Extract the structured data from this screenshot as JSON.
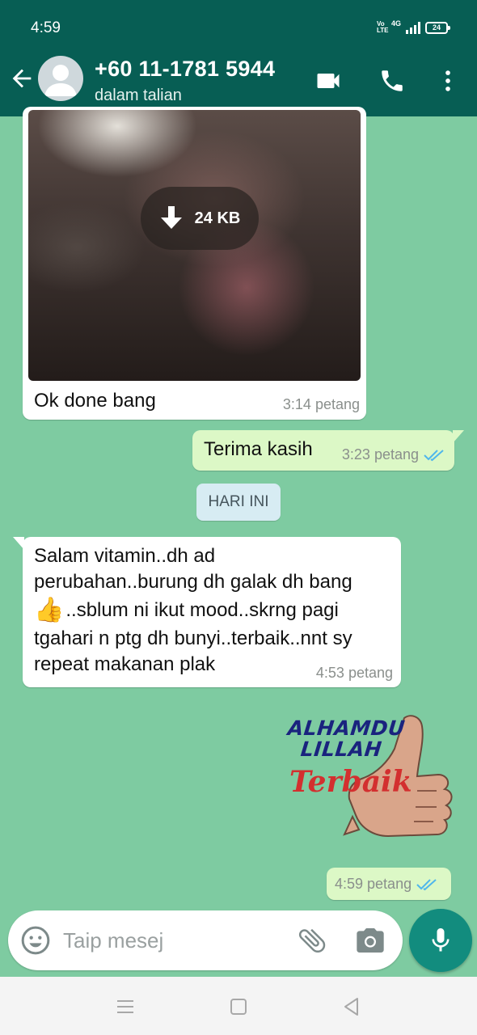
{
  "status_bar": {
    "time": "4:59",
    "volte_label": "Vo LTE",
    "network": "4G",
    "battery": "24"
  },
  "header": {
    "contact_name": "+60 11-1781 5944",
    "contact_status": "dalam talian",
    "background_color": "#075e54"
  },
  "messages": [
    {
      "direction": "incoming",
      "type": "image",
      "download_size": "24 KB",
      "caption": "Ok done bang",
      "time": "3:14 petang"
    },
    {
      "direction": "outgoing",
      "type": "text",
      "text": "Terima kasih",
      "time": "3:23 petang",
      "receipt": "read"
    },
    {
      "type": "date_separator",
      "text": "HARI INI"
    },
    {
      "direction": "incoming",
      "type": "text",
      "lines": [
        "Salam vitamin..dh ad",
        "perubahan..burung dh galak dh bang",
        "..sblum ni ikut mood..skrng pagi",
        "tgahari n ptg dh bunyi..terbaik..nnt sy",
        "repeat makanan plak"
      ],
      "emoji": "👍",
      "time": "4:53 petang"
    },
    {
      "direction": "outgoing",
      "type": "sticker",
      "sticker_lines": [
        "ALHAMDU",
        "LILLAH",
        "Terbaik"
      ],
      "time": "4:59 petang",
      "receipt": "read"
    }
  ],
  "composer": {
    "placeholder": "Taip mesej"
  },
  "colors": {
    "chat_background": "#7ecba1",
    "outgoing_bubble": "#dcf8c6",
    "incoming_bubble": "#ffffff",
    "read_ticks": "#4fb6ec",
    "mic_button": "#128c7e"
  },
  "icons": {
    "header": [
      "back-arrow-icon",
      "avatar-placeholder",
      "video-call-icon",
      "voice-call-icon",
      "more-vert-icon"
    ],
    "composer": [
      "emoji-icon",
      "attach-icon",
      "camera-icon",
      "mic-icon"
    ],
    "navigation": [
      "menu-icon",
      "home-icon",
      "back-icon"
    ]
  }
}
